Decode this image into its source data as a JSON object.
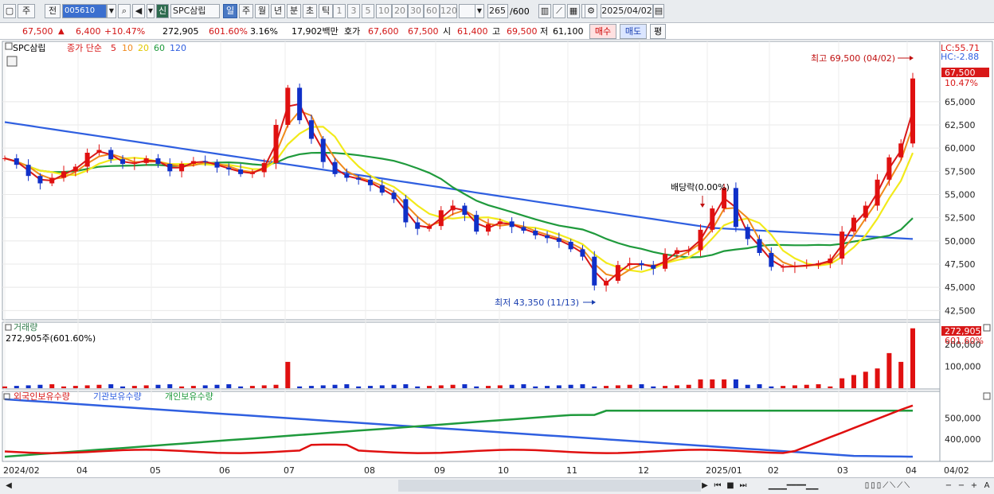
{
  "toolbar": {
    "period": "주",
    "prev": "전",
    "code": "005610",
    "new_badge": "신",
    "stock_name": "SPC삼립",
    "freq": [
      "일",
      "주",
      "월",
      "년",
      "분",
      "초",
      "틱"
    ],
    "freq_selected": "일",
    "nums": [
      "1",
      "3",
      "5",
      "10",
      "20",
      "30",
      "60",
      "120"
    ],
    "count": "265",
    "count_total": "/600",
    "date": "2025/04/02"
  },
  "quote": {
    "price": "67,500",
    "change": "6,400",
    "change_pct": "+10.47%",
    "volume": "272,905",
    "vol_ratio": "601.60%",
    "turnover_pct": "3.16%",
    "amount": "17,902백만",
    "ask_label": "호가",
    "ask1": "67,600",
    "ask2": "67,500",
    "open_label": "시",
    "open": "61,400",
    "high_label": "고",
    "high": "69,500",
    "low_label": "저",
    "low": "61,100",
    "buy": "매수",
    "sell": "매도",
    "avg": "평"
  },
  "legend": {
    "name": "SPC삼립",
    "ma_label": "종가 단순",
    "ma5": "5",
    "ma10": "10",
    "ma20": "20",
    "ma60": "60",
    "ma120": "120",
    "lc": "LC:55.71",
    "hc": "HC:-2.88",
    "max_label": "최고 69,500 (04/02)",
    "min_label": "최저 43,350 (11/13)",
    "dividend_label": "배당락(0.00%)",
    "cur_price": "67,500",
    "cur_pct": "10.47%"
  },
  "volume_panel": {
    "title": "거래량",
    "sub": "272,905주(601.60%)",
    "cur": "272,905",
    "pct": "601.60%"
  },
  "holdings_panel": {
    "foreign": "외국인보유수량",
    "inst": "기관보유수량",
    "indiv": "개인보유수량"
  },
  "colors": {
    "up": "#e01010",
    "down": "#1030c8",
    "ma5": "#d81818",
    "ma10": "#f08a1c",
    "ma20": "#f2ea1a",
    "ma60": "#1f9a3c",
    "ma120": "#2f5fe0"
  },
  "chart_data": [
    {
      "type": "candlestick",
      "title": "SPC삼립",
      "price_axis": [
        "65,000",
        "62,500",
        "60,000",
        "57,500",
        "55,000",
        "52,500",
        "50,000",
        "47,500",
        "45,000",
        "42,500"
      ],
      "ylim": [
        41500,
        71500
      ],
      "x_labels": [
        "2024/02",
        "04",
        "05",
        "06",
        "07",
        "08",
        "09",
        "10",
        "11",
        "12",
        "2025/01",
        "02",
        "03",
        "04",
        "04/02"
      ],
      "close": [
        58900,
        58200,
        57000,
        56200,
        56800,
        57500,
        58000,
        59500,
        59800,
        58800,
        58300,
        58400,
        58900,
        58300,
        57500,
        58300,
        58600,
        58500,
        57900,
        57700,
        57200,
        57400,
        58400,
        62500,
        66500,
        63000,
        61000,
        58500,
        57200,
        56800,
        56600,
        56000,
        55200,
        54500,
        52000,
        51300,
        51600,
        53300,
        53800,
        52800,
        51000,
        51800,
        52100,
        51500,
        51100,
        50600,
        50300,
        49900,
        49100,
        48300,
        45200,
        45700,
        47400,
        47600,
        47400,
        47000,
        48600,
        49000,
        49000,
        51200,
        53500,
        55700,
        51500,
        50200,
        48700,
        47200,
        47200,
        47300,
        47400,
        47600,
        48100,
        51000,
        52500,
        53800,
        56600,
        59000,
        60500,
        67500
      ],
      "high": 69500,
      "low": 43350,
      "high_date": "04/02",
      "low_date": "11/13"
    },
    {
      "type": "bar",
      "title": "거래량",
      "y_axis": [
        "200,000",
        "100,000"
      ],
      "ylim": [
        0,
        290000
      ],
      "last_value": 272905
    },
    {
      "type": "line",
      "title": "보유수량",
      "y_axis": [
        "500,000",
        "400,000"
      ],
      "series": [
        {
          "name": "외국인보유수량"
        },
        {
          "name": "기관보유수량"
        },
        {
          "name": "개인보유수량"
        }
      ]
    }
  ]
}
